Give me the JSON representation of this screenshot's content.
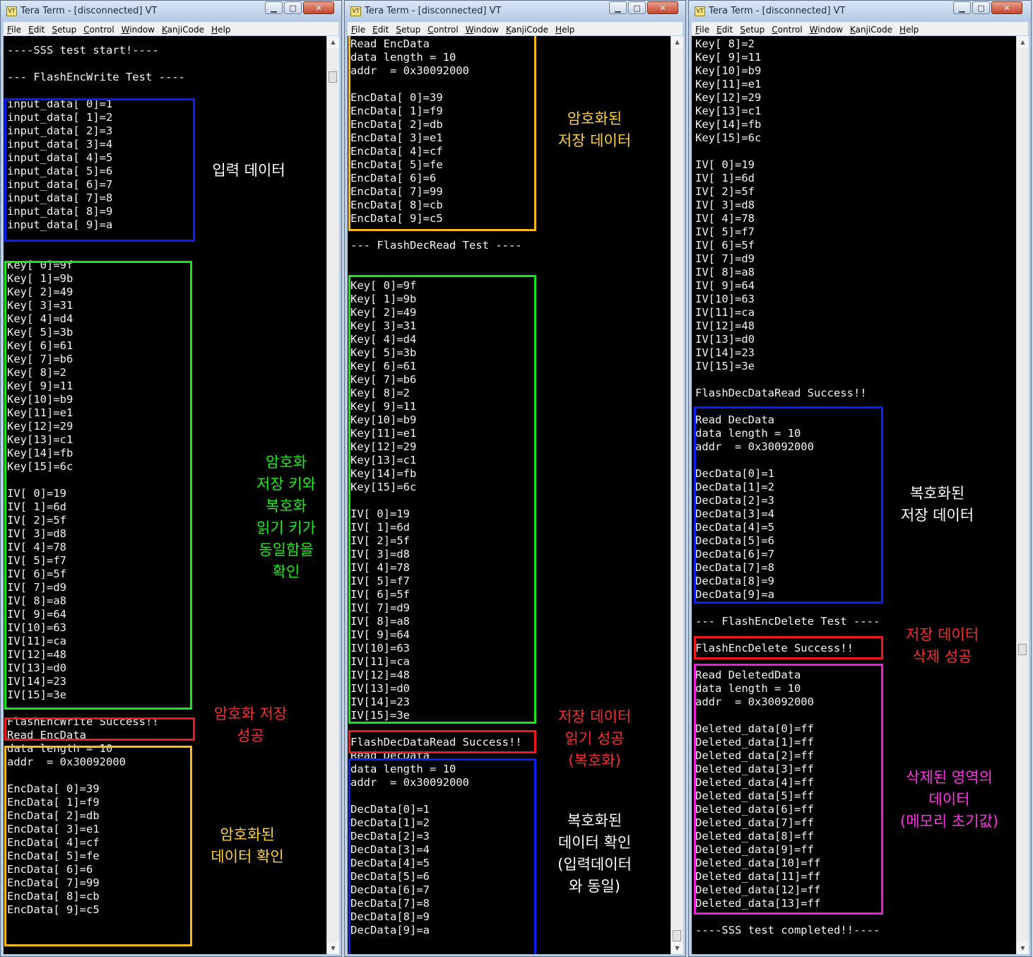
{
  "windows": [
    {
      "title": "Tera Term - [disconnected] VT",
      "menu": [
        "File",
        "Edit",
        "Setup",
        "Control",
        "Window",
        "KanjiCode",
        "Help"
      ],
      "lines": [
        "",
        "----SSS test start!----",
        "",
        "--- FlashEncWrite Test ----",
        "",
        "input_data[ 0]=1",
        "input_data[ 1]=2",
        "input_data[ 2]=3",
        "input_data[ 3]=4",
        "input_data[ 4]=5",
        "input_data[ 5]=6",
        "input_data[ 6]=7",
        "input_data[ 7]=8",
        "input_data[ 8]=9",
        "input_data[ 9]=a",
        "",
        "",
        "Key[ 0]=9f",
        "Key[ 1]=9b",
        "Key[ 2]=49",
        "Key[ 3]=31",
        "Key[ 4]=d4",
        "Key[ 5]=3b",
        "Key[ 6]=61",
        "Key[ 7]=b6",
        "Key[ 8]=2",
        "Key[ 9]=11",
        "Key[10]=b9",
        "Key[11]=e1",
        "Key[12]=29",
        "Key[13]=c1",
        "Key[14]=fb",
        "Key[15]=6c",
        "",
        "IV[ 0]=19",
        "IV[ 1]=6d",
        "IV[ 2]=5f",
        "IV[ 3]=d8",
        "IV[ 4]=78",
        "IV[ 5]=f7",
        "IV[ 6]=5f",
        "IV[ 7]=d9",
        "IV[ 8]=a8",
        "IV[ 9]=64",
        "IV[10]=63",
        "IV[11]=ca",
        "IV[12]=48",
        "IV[13]=d0",
        "IV[14]=23",
        "IV[15]=3e",
        "",
        "FlashEncWrite Success!!",
        "Read EncData",
        "data length = 10",
        "addr  = 0x30092000",
        "",
        "EncData[ 0]=39",
        "EncData[ 1]=f9",
        "EncData[ 2]=db",
        "EncData[ 3]=e1",
        "EncData[ 4]=cf",
        "EncData[ 5]=fe",
        "EncData[ 6]=6",
        "EncData[ 7]=99",
        "EncData[ 8]=cb",
        "EncData[ 9]=c5"
      ],
      "annotations": [
        {
          "color": "white",
          "lines": [
            "입력 데이터"
          ]
        },
        {
          "color": "green",
          "lines": [
            "암호화",
            "저장 키와",
            "복호화",
            "읽기 키가",
            "동일함을",
            "확인"
          ]
        },
        {
          "color": "red",
          "lines": [
            "암호화 저장",
            "성공"
          ]
        },
        {
          "color": "yellow",
          "lines": [
            "암호화된",
            "데이터 확인"
          ]
        }
      ]
    },
    {
      "title": "Tera Term - [disconnected] VT",
      "menu": [
        "File",
        "Edit",
        "Setup",
        "Control",
        "Window",
        "KanjiCode",
        "Help"
      ],
      "lines": [
        "Read EncData",
        "data length = 10",
        "addr  = 0x30092000",
        "",
        "EncData[ 0]=39",
        "EncData[ 1]=f9",
        "EncData[ 2]=db",
        "EncData[ 3]=e1",
        "EncData[ 4]=cf",
        "EncData[ 5]=fe",
        "EncData[ 6]=6",
        "EncData[ 7]=99",
        "EncData[ 8]=cb",
        "EncData[ 9]=c5",
        "",
        "--- FlashDecRead Test ----",
        "",
        "",
        "Key[ 0]=9f",
        "Key[ 1]=9b",
        "Key[ 2]=49",
        "Key[ 3]=31",
        "Key[ 4]=d4",
        "Key[ 5]=3b",
        "Key[ 6]=61",
        "Key[ 7]=b6",
        "Key[ 8]=2",
        "Key[ 9]=11",
        "Key[10]=b9",
        "Key[11]=e1",
        "Key[12]=29",
        "Key[13]=c1",
        "Key[14]=fb",
        "Key[15]=6c",
        "",
        "IV[ 0]=19",
        "IV[ 1]=6d",
        "IV[ 2]=5f",
        "IV[ 3]=d8",
        "IV[ 4]=78",
        "IV[ 5]=f7",
        "IV[ 6]=5f",
        "IV[ 7]=d9",
        "IV[ 8]=a8",
        "IV[ 9]=64",
        "IV[10]=63",
        "IV[11]=ca",
        "IV[12]=48",
        "IV[13]=d0",
        "IV[14]=23",
        "IV[15]=3e",
        "",
        "FlashDecDataRead Success!!",
        "Read DecData",
        "data length = 10",
        "addr  = 0x30092000",
        "",
        "DecData[0]=1",
        "DecData[1]=2",
        "DecData[2]=3",
        "DecData[3]=4",
        "DecData[4]=5",
        "DecData[5]=6",
        "DecData[6]=7",
        "DecData[7]=8",
        "DecData[8]=9",
        "DecData[9]=a"
      ],
      "annotations": [
        {
          "color": "yellow",
          "lines": [
            "암호화된",
            "저장 데이터"
          ]
        },
        {
          "color": "red",
          "lines": [
            "저장 데이터",
            "읽기 성공",
            "(복호화)"
          ]
        },
        {
          "color": "white",
          "lines": [
            "복호화된",
            "데이터 확인",
            "(입력데이터",
            "와 동일)"
          ]
        }
      ]
    },
    {
      "title": "Tera Term - [disconnected] VT",
      "menu": [
        "File",
        "Edit",
        "Setup",
        "Control",
        "Window",
        "KanjiCode",
        "Help"
      ],
      "lines": [
        "Key[ 8]=2",
        "Key[ 9]=11",
        "Key[10]=b9",
        "Key[11]=e1",
        "Key[12]=29",
        "Key[13]=c1",
        "Key[14]=fb",
        "Key[15]=6c",
        "",
        "IV[ 0]=19",
        "IV[ 1]=6d",
        "IV[ 2]=5f",
        "IV[ 3]=d8",
        "IV[ 4]=78",
        "IV[ 5]=f7",
        "IV[ 6]=5f",
        "IV[ 7]=d9",
        "IV[ 8]=a8",
        "IV[ 9]=64",
        "IV[10]=63",
        "IV[11]=ca",
        "IV[12]=48",
        "IV[13]=d0",
        "IV[14]=23",
        "IV[15]=3e",
        "",
        "FlashDecDataRead Success!!",
        "",
        "Read DecData",
        "data length = 10",
        "addr  = 0x30092000",
        "",
        "DecData[0]=1",
        "DecData[1]=2",
        "DecData[2]=3",
        "DecData[3]=4",
        "DecData[4]=5",
        "DecData[5]=6",
        "DecData[6]=7",
        "DecData[7]=8",
        "DecData[8]=9",
        "DecData[9]=a",
        "",
        "--- FlashEncDelete Test ----",
        "",
        "FlashEncDelete Success!!",
        "",
        "Read DeletedData",
        "data length = 10",
        "addr  = 0x30092000",
        "",
        "Deleted_data[0]=ff",
        "Deleted_data[1]=ff",
        "Deleted_data[2]=ff",
        "Deleted_data[3]=ff",
        "Deleted_data[4]=ff",
        "Deleted_data[5]=ff",
        "Deleted_data[6]=ff",
        "Deleted_data[7]=ff",
        "Deleted_data[8]=ff",
        "Deleted_data[9]=ff",
        "Deleted_data[10]=ff",
        "Deleted_data[11]=ff",
        "Deleted_data[12]=ff",
        "Deleted_data[13]=ff",
        "",
        "----SSS test completed!!----"
      ],
      "annotations": [
        {
          "color": "white",
          "lines": [
            "복호화된",
            "저장 데이터"
          ]
        },
        {
          "color": "red",
          "lines": [
            "저장 데이터",
            "삭제 성공"
          ]
        },
        {
          "color": "pink",
          "lines": [
            "삭제된 영역의",
            "데이터",
            "(메모리 초기값)"
          ]
        }
      ]
    }
  ],
  "controls": {
    "minimize": "▁",
    "maximize": "□",
    "close": "✕",
    "app_icon": "VT",
    "scroll_up": "▲",
    "scroll_down": "▼"
  }
}
